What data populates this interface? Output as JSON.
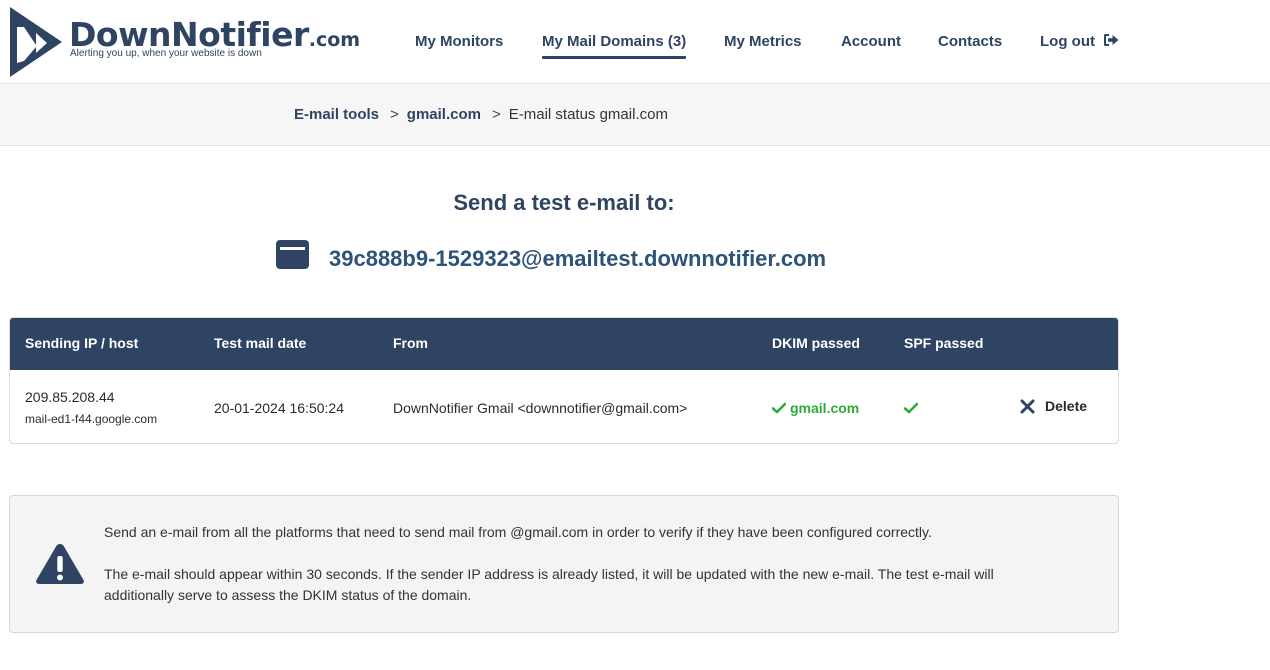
{
  "brand": {
    "name": "DownNotifier",
    "tld": ".com",
    "tagline": "Alerting you up, when your website is down"
  },
  "nav": {
    "monitors": "My Monitors",
    "mail_domains": "My Mail Domains (3)",
    "metrics": "My Metrics",
    "account": "Account",
    "contacts": "Contacts",
    "logout": "Log out"
  },
  "breadcrumb": {
    "root": "E-mail tools",
    "domain": "gmail.com",
    "current": "E-mail status gmail.com",
    "separator": ">"
  },
  "test_email": {
    "title": "Send a test e-mail to:",
    "address": "39c888b9-1529323@emailtest.downnotifier.com"
  },
  "table": {
    "headers": {
      "ip": "Sending IP / host",
      "date": "Test mail date",
      "from": "From",
      "dkim": "DKIM passed",
      "spf": "SPF passed"
    },
    "rows": [
      {
        "ip": "209.85.208.44",
        "host": "mail-ed1-f44.google.com",
        "date": "20-01-2024 16:50:24",
        "from": "DownNotifier Gmail <downnotifier@gmail.com>",
        "dkim": "gmail.com",
        "spf_passed": true,
        "delete_label": "Delete"
      }
    ]
  },
  "info": {
    "line1": "Send an e-mail from all the platforms that need to send mail from @gmail.com in order to verify if they have been configured correctly.",
    "line2": "The e-mail should appear within 30 seconds. If the sender IP address is already listed, it will be updated with the new e-mail. The test e-mail will additionally serve to assess the DKIM status of the domain."
  },
  "colors": {
    "brand_navy": "#2e4462",
    "success_green": "#2eaa3a",
    "email_blue": "#2e5379"
  }
}
